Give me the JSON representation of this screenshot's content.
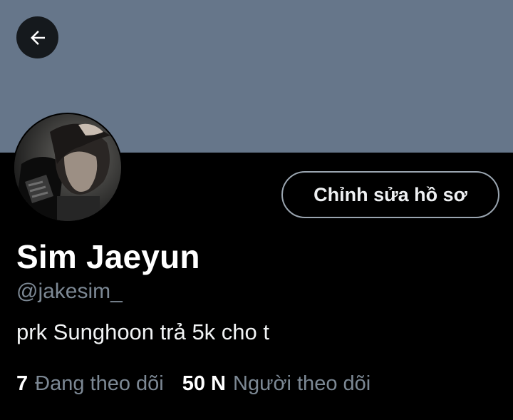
{
  "header": {
    "back_icon": "arrow-left-icon"
  },
  "profile": {
    "name": "Sim Jaeyun",
    "handle": "@jakesim_",
    "bio": "prk Sunghoon trả 5k cho t",
    "edit_label": "Chỉnh sửa hồ sơ",
    "following_count": "7",
    "following_label": "Đang theo dõi",
    "followers_count": "50 N",
    "followers_label": "Người theo dõi"
  },
  "colors": {
    "banner": "#66768a",
    "background": "#000000",
    "secondary_text": "#7c8894"
  }
}
